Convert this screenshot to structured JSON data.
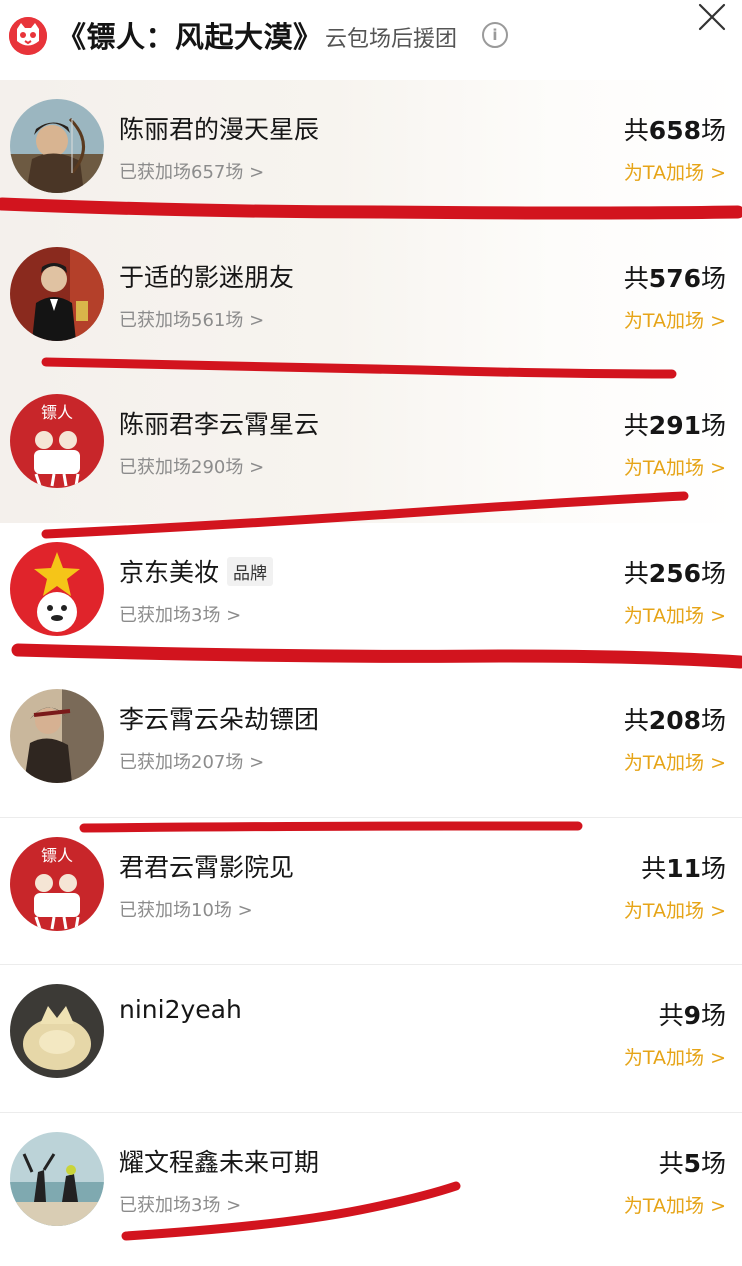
{
  "header": {
    "title": "《镖人：风起大漠》",
    "subtitle": "云包场后援团",
    "info_icon": "info-icon",
    "close_icon": "close-icon"
  },
  "list": [
    {
      "name": "陈丽君的漫天星辰",
      "tag": "",
      "gained": "已获加场657场 >",
      "total_prefix": "共",
      "total_num": "658",
      "total_suffix": "场",
      "boost": "为TA加场 >"
    },
    {
      "name": "于适的影迷朋友",
      "tag": "",
      "gained": "已获加场561场 >",
      "total_prefix": "共",
      "total_num": "576",
      "total_suffix": "场",
      "boost": "为TA加场 >"
    },
    {
      "name": "陈丽君李云霄星云",
      "tag": "",
      "gained": "已获加场290场 >",
      "total_prefix": "共",
      "total_num": "291",
      "total_suffix": "场",
      "boost": "为TA加场 >"
    },
    {
      "name": "京东美妆",
      "tag": "品牌",
      "gained": "已获加场3场 >",
      "total_prefix": "共",
      "total_num": "256",
      "total_suffix": "场",
      "boost": "为TA加场 >"
    },
    {
      "name": "李云霄云朵劫镖团",
      "tag": "",
      "gained": "已获加场207场 >",
      "total_prefix": "共",
      "total_num": "208",
      "total_suffix": "场",
      "boost": "为TA加场 >"
    },
    {
      "name": "君君云霄影院见",
      "tag": "",
      "gained": "已获加场10场 >",
      "total_prefix": "共",
      "total_num": "11",
      "total_suffix": "场",
      "boost": "为TA加场 >"
    },
    {
      "name": "nini2yeah",
      "tag": "",
      "gained": "",
      "total_prefix": "共",
      "total_num": "9",
      "total_suffix": "场",
      "boost": "为TA加场 >"
    },
    {
      "name": "耀文程鑫未来可期",
      "tag": "",
      "gained": "已获加场3场 >",
      "total_prefix": "共",
      "total_num": "5",
      "total_suffix": "场",
      "boost": "为TA加场 >"
    }
  ],
  "colors": {
    "accent_gold": "#e6a417",
    "marker_red": "#d2141e",
    "logo_red": "#e8343a"
  }
}
